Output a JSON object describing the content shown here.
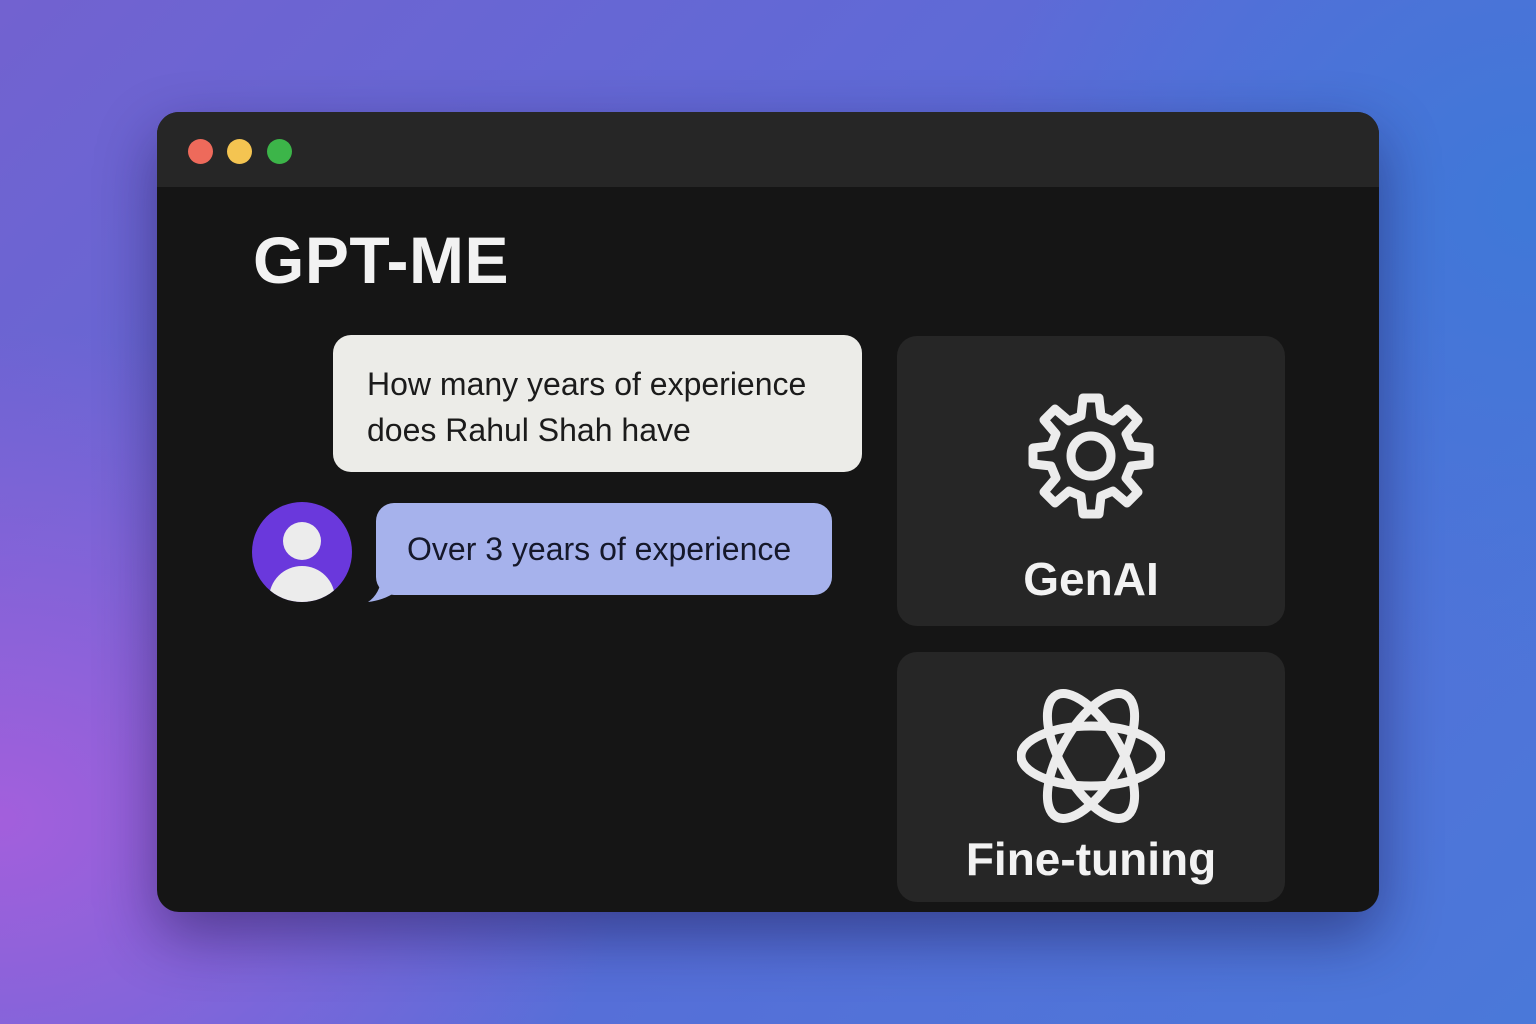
{
  "window": {
    "controls": [
      {
        "name": "close",
        "color": "#ee6a5b"
      },
      {
        "name": "minimize",
        "color": "#f4c451"
      },
      {
        "name": "zoom",
        "color": "#3cb549"
      }
    ]
  },
  "app": {
    "title": "GPT-ME"
  },
  "chat": {
    "question": "How many years of experience does Rahul Shah have",
    "answer": "Over 3 years of experience",
    "avatar_icon": "user-avatar-icon",
    "question_bubble_color": "#ecece8",
    "answer_bubble_color": "#a6b2ec",
    "avatar_color": "#6a38dc"
  },
  "cards": [
    {
      "label": "GenAI",
      "icon": "gear-icon"
    },
    {
      "label": "Fine-tuning",
      "icon": "atom-icon"
    }
  ]
}
